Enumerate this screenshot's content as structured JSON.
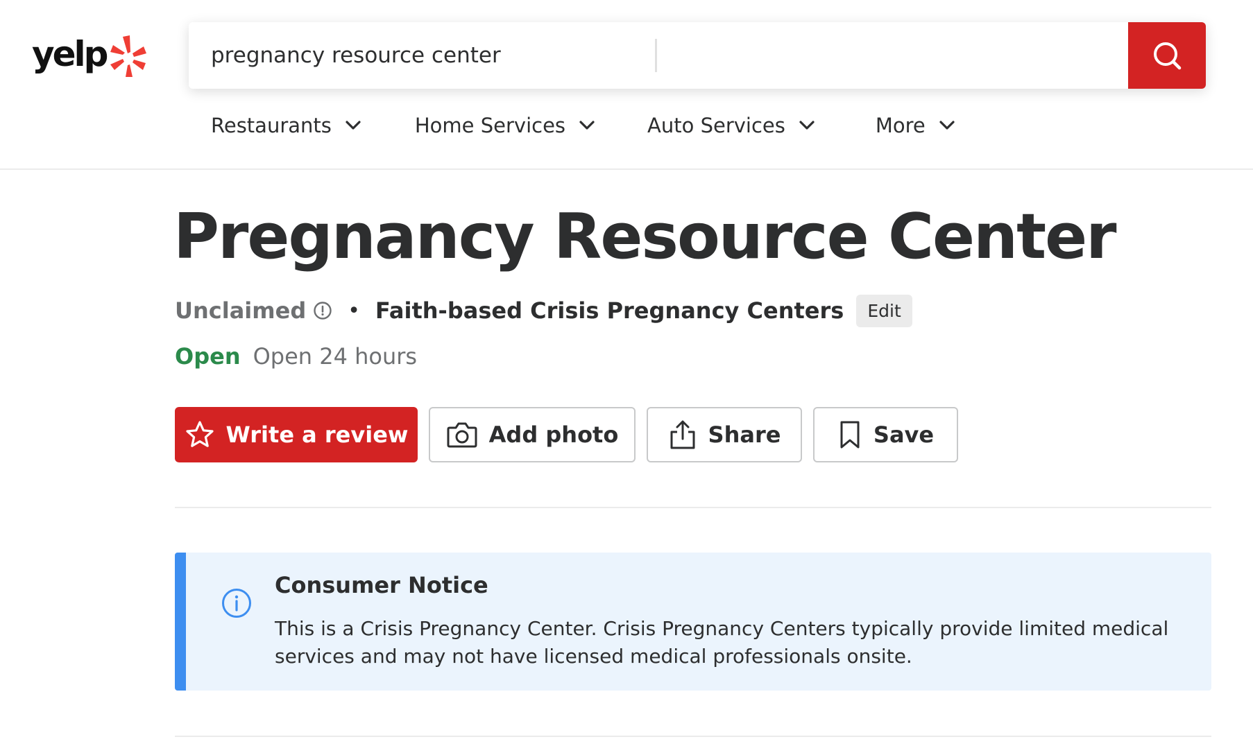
{
  "brand": {
    "name": "yelp",
    "accent_color": "#d32323"
  },
  "search": {
    "find_value": "pregnancy resource center",
    "near_value": "",
    "button_icon": "search-icon"
  },
  "nav": {
    "items": [
      {
        "label": "Restaurants",
        "icon": "chevron-down-icon"
      },
      {
        "label": "Home Services",
        "icon": "chevron-down-icon"
      },
      {
        "label": "Auto Services",
        "icon": "chevron-down-icon"
      },
      {
        "label": "More",
        "icon": "chevron-down-icon"
      }
    ]
  },
  "business": {
    "name": "Pregnancy Resource Center",
    "claim_status": "Unclaimed",
    "separator": "•",
    "category": "Faith-based Crisis Pregnancy Centers",
    "edit_label": "Edit",
    "open_status": "Open",
    "hours": "Open 24 hours",
    "open_color": "#2b8a4b"
  },
  "actions": {
    "write_review": "Write a review",
    "add_photo": "Add photo",
    "share": "Share",
    "save": "Save"
  },
  "notice": {
    "title": "Consumer Notice",
    "body": "This is a Crisis Pregnancy Center. Crisis Pregnancy Centers typically provide limited medical services and may not have licensed medical professionals onsite.",
    "accent_color": "#3d8ef0",
    "background_color": "#ebf4fd"
  }
}
